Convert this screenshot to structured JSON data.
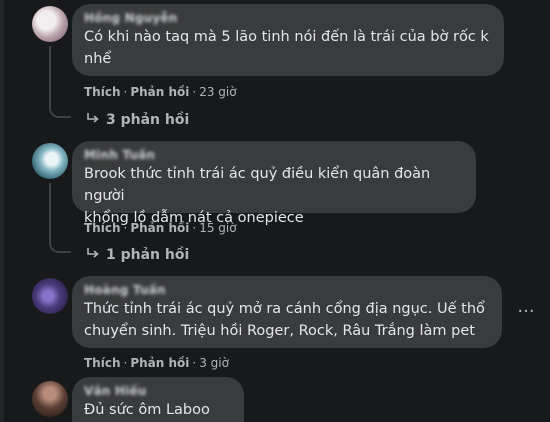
{
  "comments": [
    {
      "author": "Hồng Nguyễn",
      "text": "Có khi nào taq mà 5 lão tinh nói đến là trái của bờ rốc k\nnhể",
      "like_label": "Thích",
      "reply_label": "Phản hồi",
      "time": "23 giờ",
      "replies_label": "3 phản hồi",
      "avatar_icon": "avatar-photo"
    },
    {
      "author": "Minh Tuấn",
      "text": "Brook thức tỉnh trái ác quỷ điều kiển quân đoàn người\nkhổng lồ dẫm nát cả onepiece",
      "like_label": "Thích",
      "reply_label": "Phản hồi",
      "time": "15 giờ",
      "replies_label": "1 phản hồi",
      "avatar_icon": "avatar-photo"
    },
    {
      "author": "Hoàng Tuấn",
      "text": "Thức tỉnh trái ác quỷ mở ra cánh cổng địa ngục. Uế thổ\nchuyển sinh. Triệu hồi Roger, Rock, Râu Trắng làm pet",
      "like_label": "Thích",
      "reply_label": "Phản hồi",
      "time": "3 giờ",
      "more_label": "···",
      "avatar_icon": "avatar-photo"
    },
    {
      "author": "Văn Hiếu",
      "text": "Đủ sức ôm Laboo rồi",
      "avatar_icon": "avatar-photo"
    }
  ],
  "icons": {
    "reply_arrow": "reply-arrow-icon",
    "more": "more-options-icon"
  },
  "colors": {
    "background": "#18191a",
    "bubble": "#3a3b3c",
    "text": "#e4e6eb",
    "secondary_text": "#b0b3b8"
  }
}
